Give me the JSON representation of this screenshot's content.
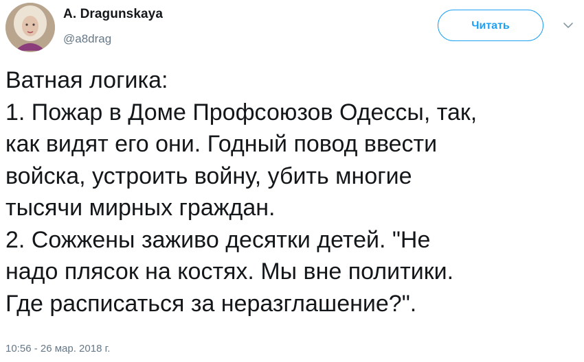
{
  "author": {
    "name": "A. Dragunskaya",
    "handle": "@a8drag",
    "avatar_icon": "user-avatar"
  },
  "follow_button": {
    "label": "Читать",
    "color": "#1da1f2"
  },
  "menu": {
    "icon": "chevron-down-icon"
  },
  "tweet": {
    "lines": [
      "Ватная логика:",
      "1. Пожар в Доме Профсоюзов Одессы, так,",
      "как видят его они. Годный повод ввести",
      "войска, устроить войну, убить многие",
      "тысячи мирных граждан.",
      "2. Сожжены заживо десятки детей. \"Не",
      "надо плясок на костях. Мы вне политики.",
      "Где расписаться за неразглашение?\"."
    ]
  },
  "timestamp": "10:56 - 26 мар. 2018 г.",
  "colors": {
    "text": "#14171a",
    "secondary": "#657786",
    "accent": "#1da1f2"
  }
}
